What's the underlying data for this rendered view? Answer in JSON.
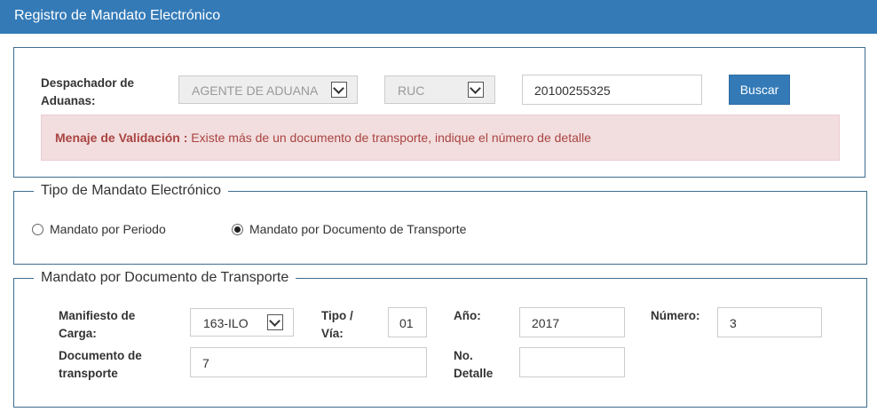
{
  "header": {
    "title": "Registro de Mandato Electrónico"
  },
  "search_panel": {
    "despachador_label_line1": "Despachador de",
    "despachador_label_line2": "Aduanas:",
    "agent_type_select": "AGENTE DE ADUANA",
    "doc_type_select": "RUC",
    "doc_number_value": "20100255325",
    "search_button": "Buscar",
    "alert_label": "Menaje de Validación :",
    "alert_message": " Existe más de un documento de transporte, indique el número de detalle"
  },
  "tipo_mandato": {
    "legend": "Tipo de Mandato Electrónico",
    "options": [
      {
        "label": "Mandato por Periodo",
        "checked": false
      },
      {
        "label": "Mandato por Documento de Transporte",
        "checked": true
      }
    ]
  },
  "mandato_documento": {
    "legend": "Mandato por Documento de Transporte",
    "manifiesto_label_line1": "Manifiesto de",
    "manifiesto_label_line2": "Carga:",
    "manifiesto_value": "163-ILO",
    "tipo_via_label_line1": "Tipo /",
    "tipo_via_label_line2": "Vía:",
    "tipo_via_value": "01",
    "anio_label": "Año:",
    "anio_value": "2017",
    "numero_label": "Número:",
    "numero_value": "3",
    "documento_label_line1": "Documento de",
    "documento_label_line2": "transporte",
    "documento_value": "7",
    "detalle_label_line1": "No.",
    "detalle_label_line2": "Detalle",
    "detalle_value": ""
  },
  "colors": {
    "header": "#337ab7",
    "alert_bg": "#f2dede",
    "alert_text": "#a94442",
    "border": "#3e6d8e"
  }
}
